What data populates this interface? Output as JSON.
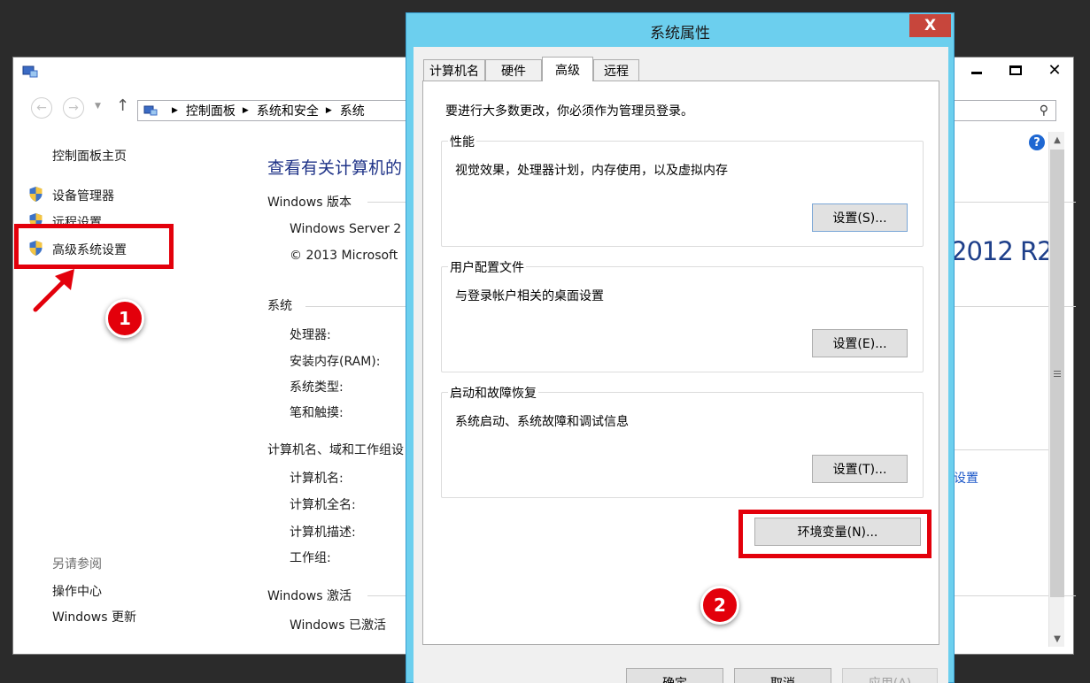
{
  "cp": {
    "address": {
      "crumb1": "控制面板",
      "crumb2": "系统和安全",
      "crumb3": "系统"
    },
    "left": {
      "home": "控制面板主页",
      "device_manager": "设备管理器",
      "remote": "远程设置",
      "advanced": "高级系统设置",
      "see_also": "另请参阅",
      "action_center": "操作中心",
      "windows_update": "Windows 更新"
    },
    "main": {
      "title": "查看有关计算机的",
      "edition_label": "Windows 版本",
      "edition_value": "Windows Server 2",
      "copyright": "© 2013 Microsoft",
      "system_label": "系统",
      "processor": "处理器:",
      "ram": "安装内存(RAM):",
      "system_type": "系统类型:",
      "pen_touch": "笔和触摸:",
      "computer_section": "计算机名、域和工作组设",
      "computer_name": "计算机名:",
      "full_name": "计算机全名:",
      "description": "计算机描述:",
      "workgroup": "工作组:",
      "activation_label": "Windows 激活",
      "activation_value": "Windows 已激活",
      "brand": "2012 R2",
      "change_link": "设置"
    },
    "help_icon_glyph": "?"
  },
  "dialog": {
    "title": "系统属性",
    "close_glyph": "X",
    "tabs": {
      "computer_name": "计算机名",
      "hardware": "硬件",
      "advanced": "高级",
      "remote": "远程"
    },
    "notice": "要进行大多数更改，你必须作为管理员登录。",
    "performance": {
      "label": "性能",
      "desc": "视觉效果，处理器计划，内存使用，以及虚拟内存",
      "button": "设置(S)..."
    },
    "profiles": {
      "label": "用户配置文件",
      "desc": "与登录帐户相关的桌面设置",
      "button": "设置(E)..."
    },
    "startup": {
      "label": "启动和故障恢复",
      "desc": "系统启动、系统故障和调试信息",
      "button": "设置(T)..."
    },
    "env_button": "环境变量(N)...",
    "ok": "确定",
    "cancel": "取消",
    "apply": "应用(A)"
  },
  "annotations": {
    "badge1": "1",
    "badge2": "2",
    "color": "#e3000b"
  }
}
